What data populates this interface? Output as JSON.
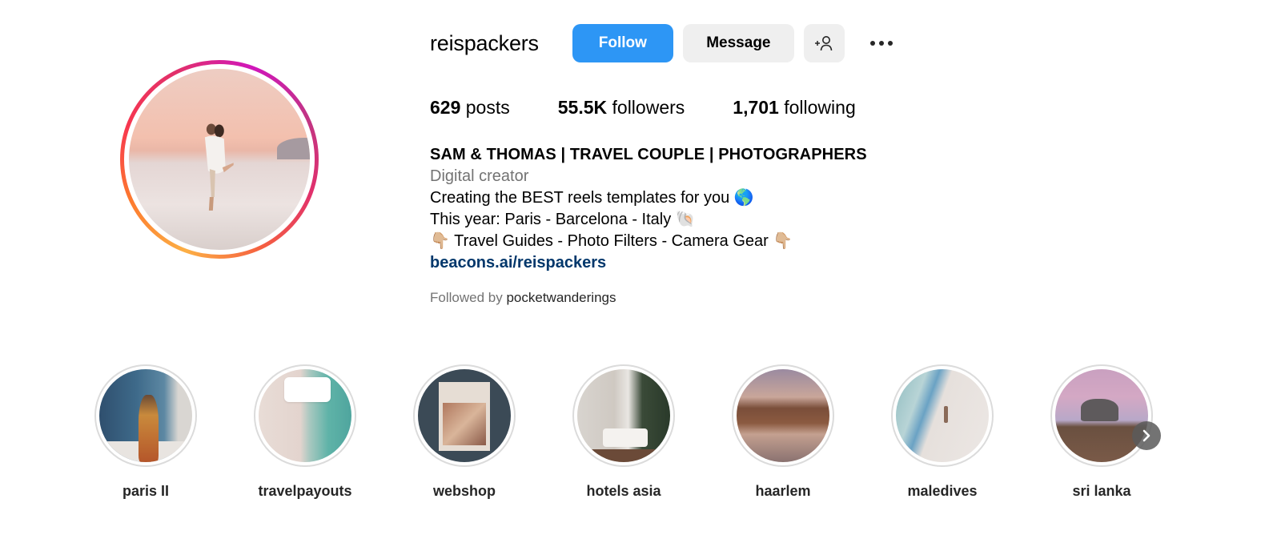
{
  "profile": {
    "username": "reispackers",
    "avatar_alt": "couple-embracing-on-white-rocks-at-sunset",
    "story_ring_colors": [
      "#fcaf45",
      "#f56040",
      "#e1306c",
      "#c13584",
      "#d016bb"
    ]
  },
  "actions": {
    "follow_label": "Follow",
    "message_label": "Message",
    "add_user_icon": "person-add-icon",
    "more_icon": "ellipsis-icon",
    "follow_color": "#2d96f5"
  },
  "stats": [
    {
      "value": "629",
      "label": "posts"
    },
    {
      "value": "55.5K",
      "label": "followers"
    },
    {
      "value": "1,701",
      "label": "following"
    }
  ],
  "bio": {
    "name": "SAM & THOMAS | TRAVEL COUPLE | PHOTOGRAPHERS",
    "category": "Digital creator",
    "lines": [
      "Creating the BEST reels templates for you 🌎",
      "This year: Paris - Barcelona - Italy 🐚",
      "👇🏼 Travel Guides - Photo Filters - Camera Gear 👇🏼"
    ],
    "link": "beacons.ai/reispackers",
    "link_color": "#00376b"
  },
  "followed_by": {
    "prefix": "Followed by",
    "user": "pocketwanderings"
  },
  "highlights": [
    {
      "label": "paris II"
    },
    {
      "label": "travelpayouts"
    },
    {
      "label": "webshop"
    },
    {
      "label": "hotels asia"
    },
    {
      "label": "haarlem"
    },
    {
      "label": "maledives"
    },
    {
      "label": "sri lanka"
    }
  ],
  "highlights_next_icon": "chevron-right-icon"
}
